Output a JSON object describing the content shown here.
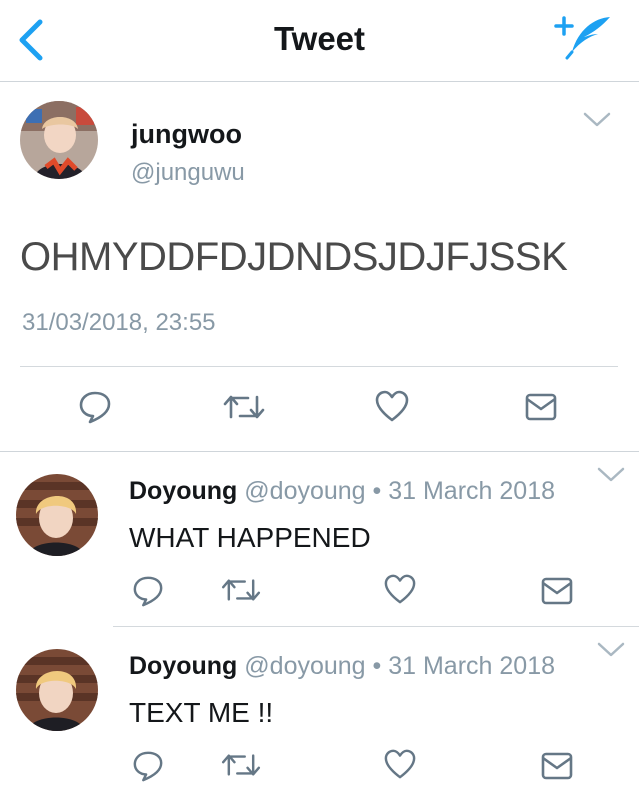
{
  "nav": {
    "title": "Tweet",
    "back_icon": "chevron-left-icon",
    "compose_icon": "compose-tweet-icon"
  },
  "colors": {
    "accent": "#1da1f2",
    "text_primary": "#14171a",
    "text_secondary": "#8899a6",
    "icon_gray": "#657786",
    "divider": "#cfd5da"
  },
  "tweet": {
    "name": "jungwoo",
    "handle": "@junguwu",
    "text": "OHMYDDFDJDNDSJDJFJSSK",
    "timestamp": "31/03/2018, 23:55",
    "actions": [
      "reply-icon",
      "retweet-icon",
      "like-icon",
      "message-icon"
    ]
  },
  "replies": [
    {
      "name": "Doyoung",
      "meta": "@doyoung • 31 March 2018",
      "text": "WHAT HAPPENED",
      "actions": [
        "reply-icon",
        "retweet-icon",
        "like-icon",
        "message-icon"
      ]
    },
    {
      "name": "Doyoung",
      "meta": "@doyoung • 31 March 2018",
      "text": "TEXT ME !!",
      "actions": [
        "reply-icon",
        "retweet-icon",
        "like-icon",
        "message-icon"
      ]
    }
  ]
}
